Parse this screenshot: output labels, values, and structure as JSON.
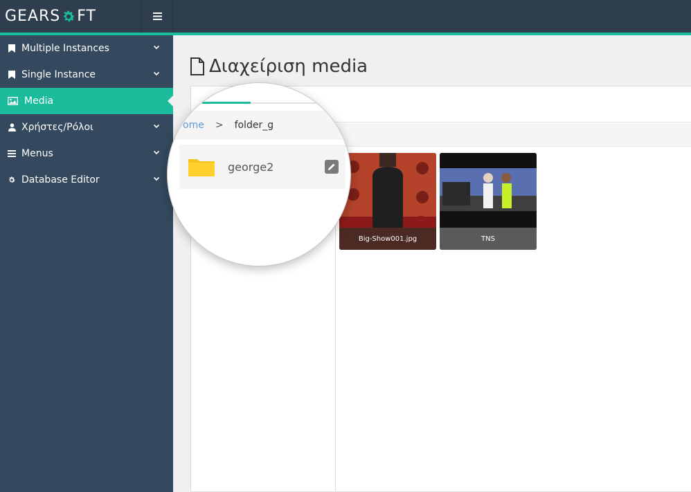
{
  "brand": {
    "text_before": "GEARS",
    "text_after": "FT",
    "accent_color": "#1abc9c"
  },
  "header": {
    "menu_icon": "hamburger-icon"
  },
  "sidebar": {
    "items": [
      {
        "label": "Multiple Instances",
        "icon": "bookmark-icon",
        "expandable": true,
        "active": false
      },
      {
        "label": "Single Instance",
        "icon": "bookmark-icon",
        "expandable": true,
        "active": false
      },
      {
        "label": "Media",
        "icon": "image-icon",
        "expandable": false,
        "active": true
      },
      {
        "label": "Χρήστες/Ρόλοι",
        "icon": "user-icon",
        "expandable": true,
        "active": false
      },
      {
        "label": "Menus",
        "icon": "list-icon",
        "expandable": true,
        "active": false
      },
      {
        "label": "Database Editor",
        "icon": "gear-icon",
        "expandable": true,
        "active": false
      }
    ]
  },
  "main": {
    "title": "Διαχείριση media",
    "title_icon": "file-icon",
    "breadcrumb": {
      "home": "ome",
      "separator": ">",
      "current": "folder_g"
    },
    "folders": [
      {
        "name": "george2",
        "icon": "folder-icon",
        "action_icon": "pencil-icon"
      }
    ],
    "files": [
      {
        "caption": "Big-Show001.jpg"
      },
      {
        "caption": "TNS"
      }
    ]
  }
}
